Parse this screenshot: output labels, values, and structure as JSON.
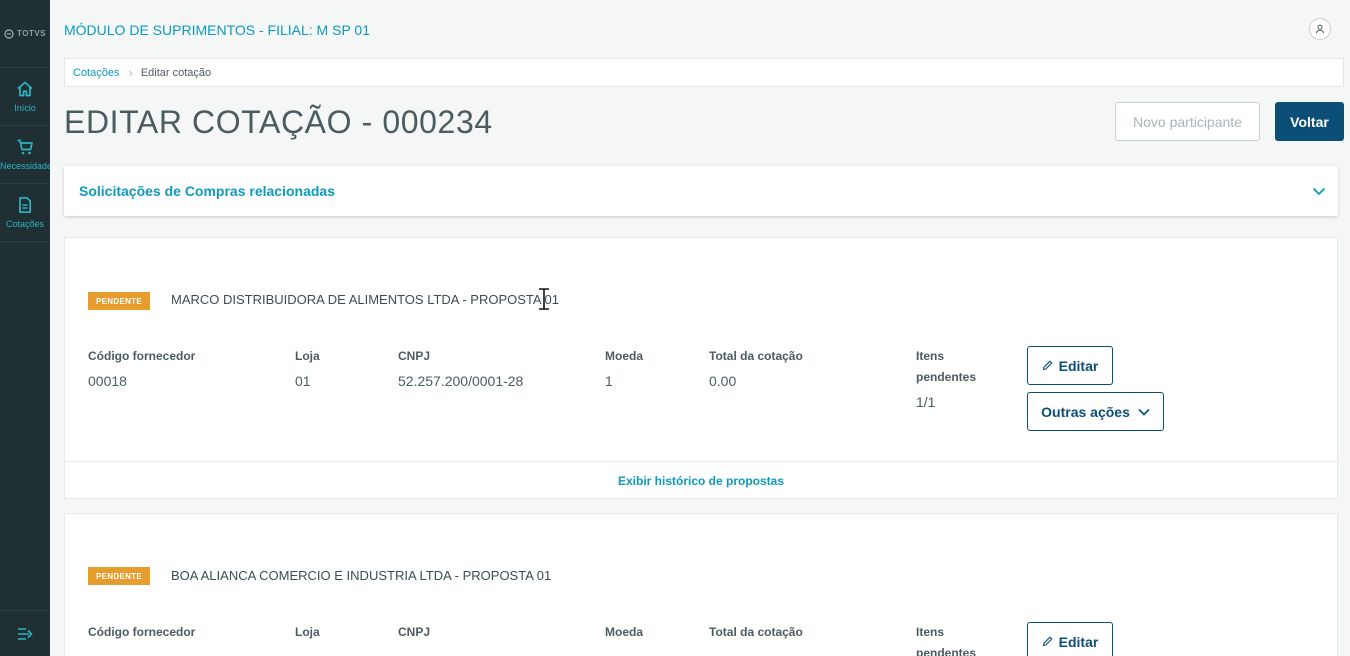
{
  "sidebar": {
    "logo_text": "TOTVS",
    "items": [
      {
        "label": "Início",
        "icon": "home-icon"
      },
      {
        "label": "Necessidade",
        "icon": "cart-icon"
      },
      {
        "label": "Cotações",
        "icon": "document-icon"
      }
    ],
    "collapse_icon": "collapse-menu-icon"
  },
  "header": {
    "title": "MÓDULO DE SUPRIMENTOS - FILIAL: M SP 01",
    "user_icon": "user-icon"
  },
  "breadcrumb": {
    "items": [
      "Cotações",
      "Editar cotação"
    ]
  },
  "page": {
    "title": "EDITAR COTAÇÃO - 000234",
    "actions": {
      "new_participant": "Novo participante",
      "back": "Voltar"
    }
  },
  "accordion": {
    "title": "Solicitações de Compras relacionadas",
    "icon": "chevron-down-icon"
  },
  "field_labels": {
    "supplier_code": "Código fornecedor",
    "store": "Loja",
    "cnpj": "CNPJ",
    "currency": "Moeda",
    "total": "Total da cotação",
    "pending_items": "Itens pendentes"
  },
  "proposals": [
    {
      "status": "PENDENTE",
      "supplier": "MARCO DISTRIBUIDORA DE ALIMENTOS LTDA - PROPOSTA 01",
      "supplier_code": "00018",
      "store": "01",
      "cnpj": "52.257.200/0001-28",
      "currency": "1",
      "total": "0.00",
      "pending_items": "1/1",
      "edit_label": "Editar",
      "more_actions_label": "Outras ações",
      "history_label": "Exibir histórico de propostas"
    },
    {
      "status": "PENDENTE",
      "supplier": "BOA ALIANCA COMERCIO E INDUSTRIA LTDA - PROPOSTA 01",
      "edit_label": "Editar"
    }
  ],
  "colors": {
    "sidebar_bg": "#1f2f33",
    "accent": "#0c9abe",
    "primary": "#0b4f77",
    "badge": "#e79d2e"
  }
}
